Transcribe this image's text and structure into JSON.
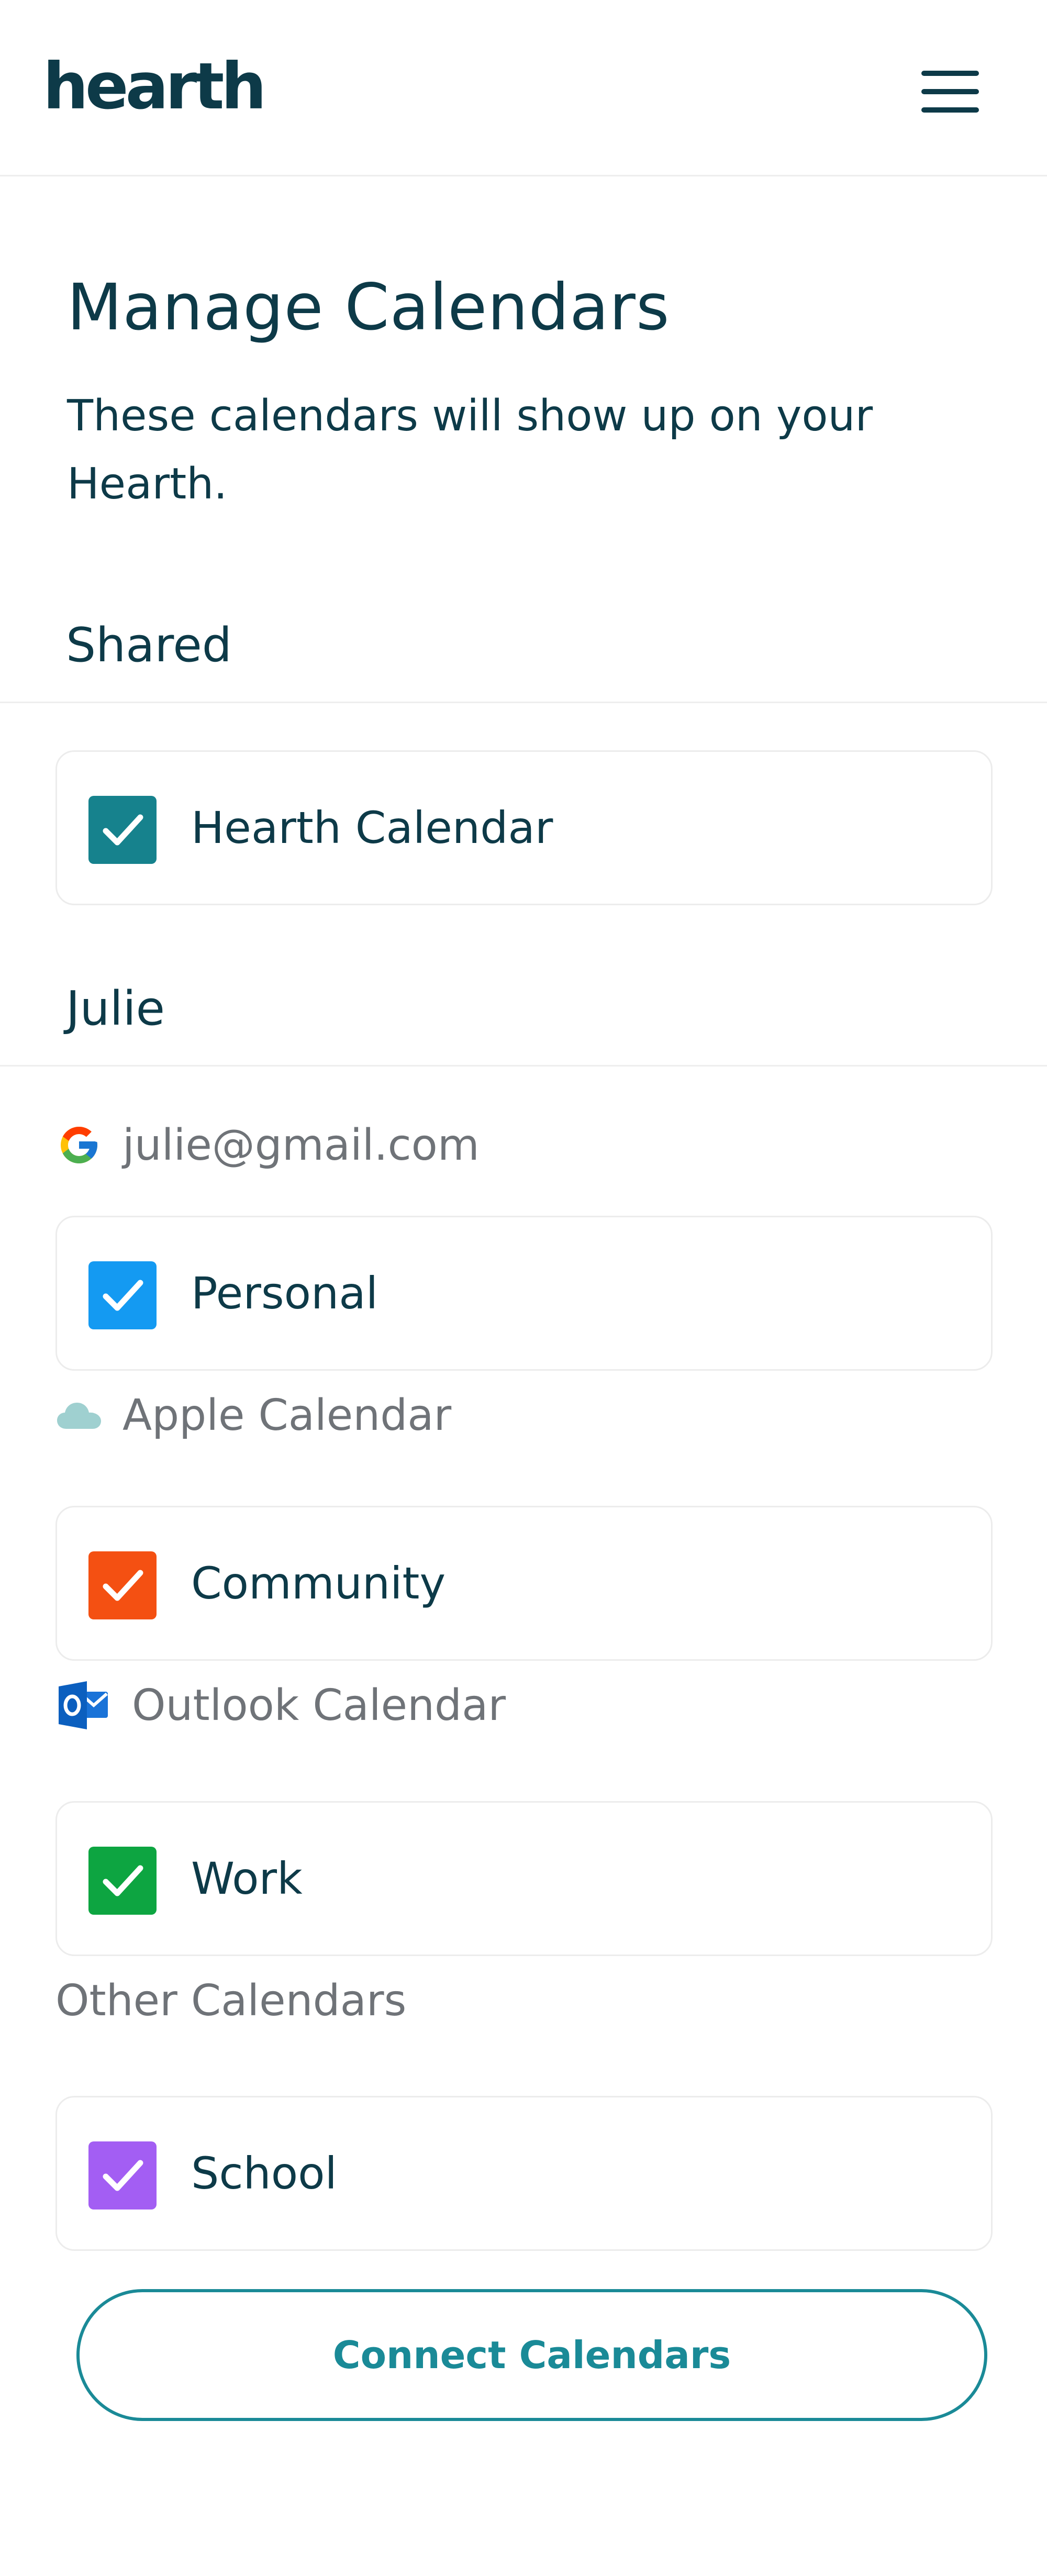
{
  "header": {
    "logo_text": "hearth",
    "menu_icon": "hamburger-menu-icon"
  },
  "page": {
    "title": "Manage Calendars",
    "subtitle": "These calendars will show up on your Hearth."
  },
  "sections": [
    {
      "title": "Shared",
      "calendars": [
        {
          "label": "Hearth Calendar",
          "checked": true,
          "color": "#16828d"
        }
      ]
    },
    {
      "title": "Julie",
      "accounts": [
        {
          "label": "julie@gmail.com",
          "icon": "google-icon",
          "calendars": [
            {
              "label": "Personal",
              "checked": true,
              "color": "#149af2"
            }
          ]
        },
        {
          "label": "Apple Calendar",
          "icon": "icloud-icon",
          "calendars": [
            {
              "label": "Community",
              "checked": true,
              "color": "#f45012"
            }
          ]
        },
        {
          "label": "Outlook Calendar",
          "icon": "outlook-icon",
          "calendars": [
            {
              "label": "Work",
              "checked": true,
              "color": "#0da541"
            }
          ]
        },
        {
          "label": "Other Calendars",
          "icon": "",
          "calendars": [
            {
              "label": "School",
              "checked": true,
              "color": "#a35ef3"
            }
          ]
        }
      ]
    }
  ],
  "actions": {
    "connect_label": "Connect Calendars"
  },
  "colors": {
    "text_dark": "#0d3a48",
    "text_muted": "#6f7378",
    "accent_teal": "#1a8a97",
    "divider": "#eeeeee"
  }
}
